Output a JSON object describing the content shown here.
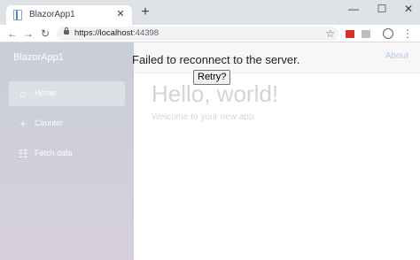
{
  "browser": {
    "tab_title": "BlazorApp1",
    "tab_close": "✕",
    "new_tab": "+",
    "window_controls": {
      "minimize": "—",
      "maximize": "☐",
      "close": "✕"
    },
    "nav": {
      "back": "←",
      "forward": "→",
      "reload": "↻"
    },
    "url_host": "https://localhost",
    "url_port": ":44398",
    "star": "☆",
    "menu": "⋮"
  },
  "sidebar": {
    "brand": "BlazorApp1",
    "items": [
      {
        "label": "Home",
        "icon": "home-icon",
        "glyph": "⌂"
      },
      {
        "label": "Counter",
        "icon": "plus-icon",
        "glyph": "+"
      },
      {
        "label": "Fetch data",
        "icon": "list-icon",
        "glyph": "☷"
      }
    ]
  },
  "main": {
    "about_link": "About",
    "heading": "Hello, world!",
    "subtext": "Welcome to your new app."
  },
  "reconnect": {
    "message": "Failed to reconnect to the server.",
    "retry_label": "Retry?"
  }
}
